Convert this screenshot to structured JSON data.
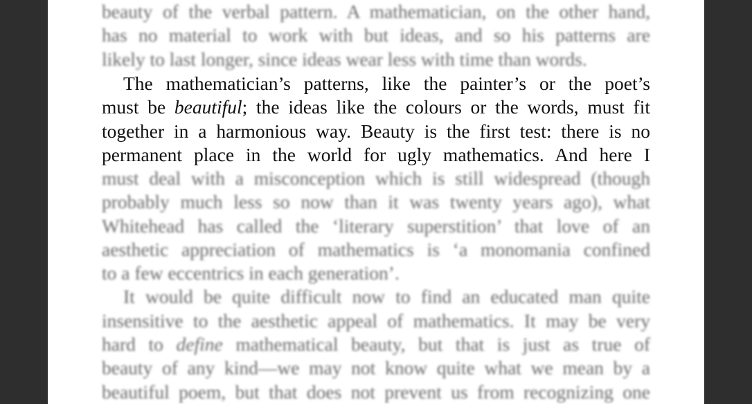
{
  "page": {
    "before": [
      "beauty of the verbal pattern. A mathematician, on the other hand,",
      "has no material to work with but ideas, and so his patterns are",
      "likely to last longer, since ideas wear less with time than words."
    ],
    "focus": [
      {
        "pre": "The mathematician’s patterns, like the painter’s or the poet’s",
        "em": "",
        "post": ""
      },
      {
        "pre": "must be ",
        "em": "beautiful",
        "post": "; the ideas like the colours or the words, must fit"
      },
      {
        "pre": "together in a harmonious way. Beauty is the first test: there is no",
        "em": "",
        "post": ""
      },
      {
        "pre": "permanent place in the world for ugly mathematics. And here I",
        "em": "",
        "post": ""
      }
    ],
    "after": [
      {
        "pre": "must deal with a misconception which is still widespread (though",
        "em": "",
        "post": ""
      },
      {
        "pre": "probably much less so now than it was twenty years ago), what",
        "em": "",
        "post": ""
      },
      {
        "pre": "Whitehead has called the ‘literary superstition’ that love of an",
        "em": "",
        "post": ""
      },
      {
        "pre": "aesthetic appreciation of mathematics is ‘a monomania confined",
        "em": "",
        "post": ""
      },
      {
        "pre": "to a few eccentrics in each generation’.",
        "em": "",
        "post": ""
      },
      {
        "pre": "It would be quite difficult now to find an educated man quite",
        "em": "",
        "post": ""
      },
      {
        "pre": "insensitive to the aesthetic appeal of mathematics. It may be very",
        "em": "",
        "post": ""
      },
      {
        "pre": "hard to ",
        "em": "define",
        "post": " mathematical beauty, but that is just as true of"
      },
      {
        "pre": "beauty of any kind—we may not know quite what we mean by a",
        "em": "",
        "post": ""
      },
      {
        "pre": "beautiful poem, but that does not prevent us from recognizing one",
        "em": "",
        "post": ""
      }
    ]
  }
}
